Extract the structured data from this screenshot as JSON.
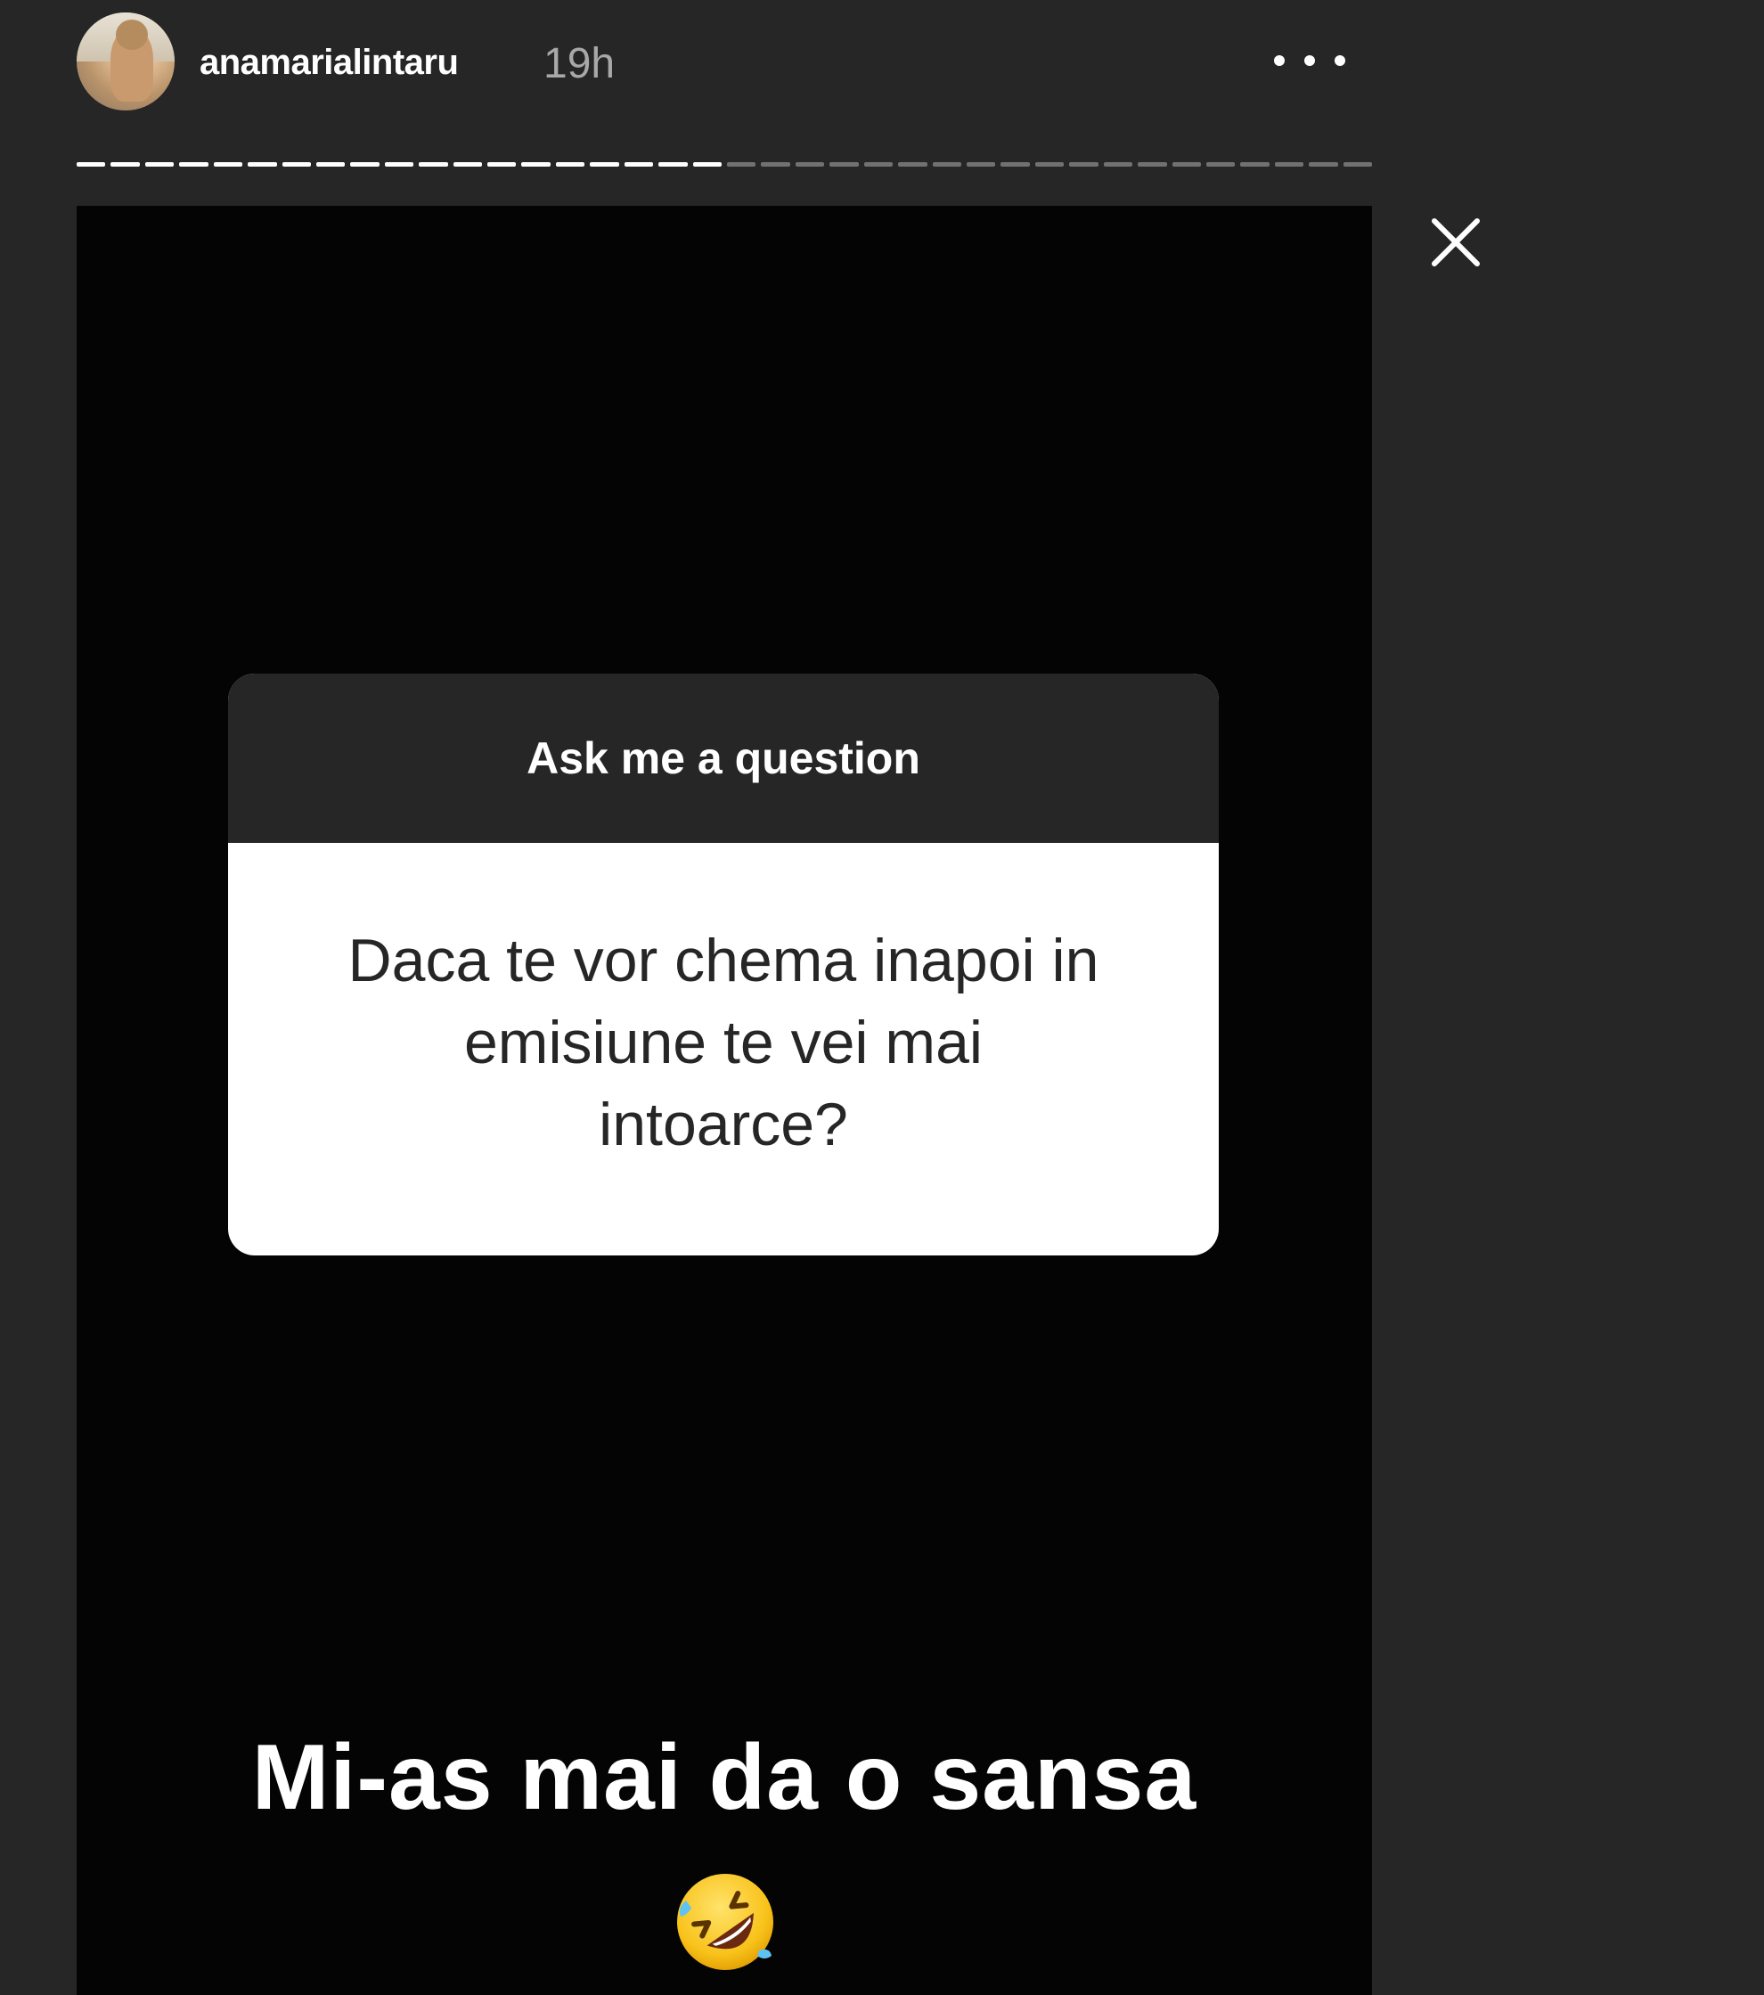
{
  "header": {
    "username": "anamarialintaru",
    "time": "19h",
    "more_icon": "more-horizontal-icon",
    "close_icon": "close-icon"
  },
  "progress": {
    "segments_total": 38,
    "segments_viewed": 19
  },
  "question_sticker": {
    "title": "Ask me a question",
    "question_lines": [
      "Daca te vor chema inapoi in",
      "emisiune te vei mai",
      "intoarce?"
    ]
  },
  "answer": {
    "text": "Mi-as mai da o sansa",
    "emoji": "rolling-on-floor-laughing-emoji"
  },
  "colors": {
    "background": "#262626",
    "story_background": "#050404",
    "sticker_body": "#ffffff",
    "sticker_header": "#262626",
    "timestamp": "#a8a8a8"
  }
}
